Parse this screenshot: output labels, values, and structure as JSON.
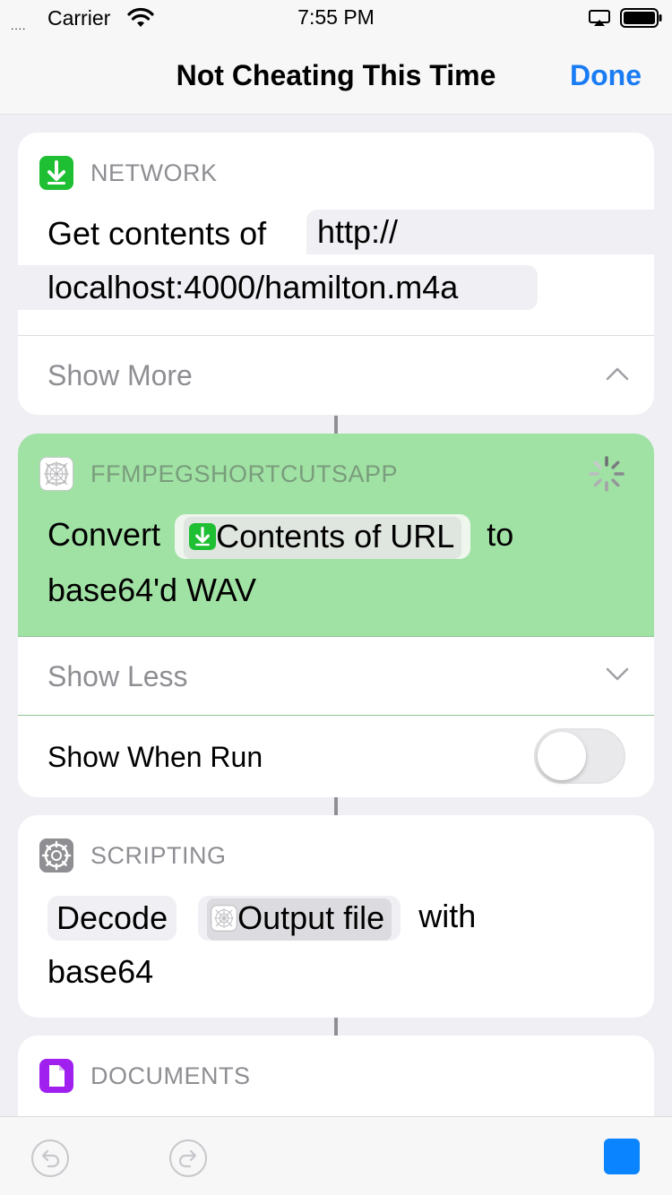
{
  "status_bar": {
    "signal": "....",
    "carrier": "Carrier",
    "time": "7:55 PM"
  },
  "nav": {
    "title": "Not Cheating This Time",
    "done_label": "Done"
  },
  "actions": {
    "network": {
      "category": "NETWORK",
      "verb": "Get contents of",
      "url": "http://localhost:4000/hamilton.m4a",
      "url_line1": "http://",
      "url_line2": "localhost:4000/hamilton.m4a",
      "show_more": "Show More",
      "icon": "download-arrow-icon",
      "color": "#1db954"
    },
    "ffmpeg": {
      "category": "FFMPEGSHORTCUTSAPP",
      "verb": "Convert",
      "token": "Contents of URL",
      "connector": "to",
      "target": "base64'd WAV",
      "show_less": "Show Less",
      "show_when_run": "Show When Run",
      "show_when_run_on": false,
      "background_color": "#a0e1a4",
      "icon": "app-grid-icon"
    },
    "scripting": {
      "category": "SCRIPTING",
      "mode": "Decode",
      "token": "Output file",
      "with": "with",
      "encoding": "base64",
      "icon": "gear-icon",
      "color": "#8e8e93"
    },
    "documents": {
      "category": "DOCUMENTS",
      "icon": "document-icon",
      "color": "#a020f0"
    }
  },
  "toolbar": {
    "undo_icon": "undo-icon",
    "redo_icon": "redo-icon",
    "stop_icon": "stop-icon"
  }
}
